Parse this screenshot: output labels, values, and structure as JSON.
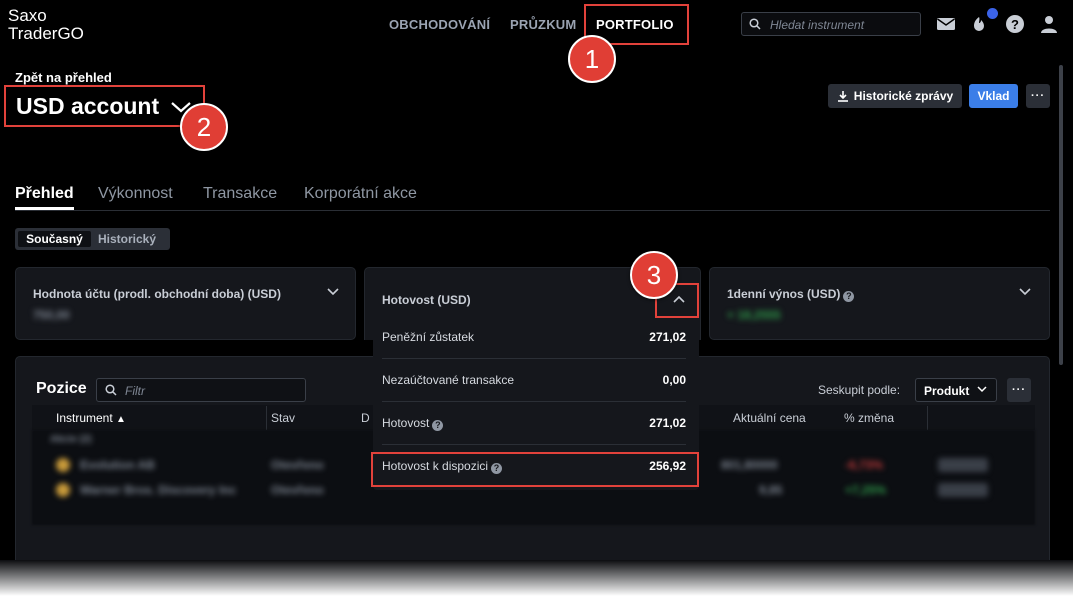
{
  "app": {
    "logo_line1": "Saxo",
    "logo_line2": "TraderGO"
  },
  "nav": {
    "items": [
      "OBCHODOVÁNÍ",
      "PRŮZKUM",
      "PORTFOLIO"
    ],
    "active": "PORTFOLIO"
  },
  "search": {
    "placeholder": "Hledat instrument"
  },
  "header": {
    "back_label": "Zpět na přehled",
    "account_name": "USD account",
    "history_button": "Historické zprávy",
    "deposit_button": "Vklad",
    "more_button": "···"
  },
  "tabs": [
    "Přehled",
    "Výkonnost",
    "Transakce",
    "Korporátní akce"
  ],
  "view_toggle": {
    "current": "Současný",
    "historic": "Historický"
  },
  "cards": {
    "account_value": {
      "title": "Hodnota účtu (prodl. obchodní doba) (USD)",
      "value_hidden": "750,00"
    },
    "cash": {
      "title": "Hotovost (USD)"
    },
    "daily_return": {
      "title": "1denní výnos (USD)",
      "value_hidden": "+ 18,2555"
    }
  },
  "cash_breakdown": [
    {
      "label": "Peněžní zůstatek",
      "value": "271,02",
      "info": false
    },
    {
      "label": "Nezaúčtované transakce",
      "value": "0,00",
      "info": false
    },
    {
      "label": "Hotovost",
      "value": "271,02",
      "info": true
    },
    {
      "label": "Hotovost k dispozici",
      "value": "256,92",
      "info": true
    }
  ],
  "positions": {
    "title": "Pozice",
    "filter_placeholder": "Filtr",
    "group_label": "Seskupit podle:",
    "group_value": "Produkt",
    "columns": {
      "instrument": "Instrument",
      "status": "Stav",
      "d": "D",
      "current_price": "Aktuální cena",
      "change": "% změna"
    },
    "blurred_rows": [
      {
        "name": "Evolution AB",
        "status": "Otevřeno",
        "price": "801,80000",
        "change": "-6,73%"
      },
      {
        "name": "Warner Bros. Discovery Inc",
        "status": "Otevřeno",
        "price": "9,85",
        "change": "+7,25%"
      }
    ],
    "blurred_group": "Akcie (2)"
  },
  "annotations": [
    "1",
    "2",
    "3"
  ],
  "colors": {
    "accent_blue": "#3b7ee8",
    "annotation_red": "#e03e35",
    "background": "#000000",
    "card": "#15171c"
  }
}
